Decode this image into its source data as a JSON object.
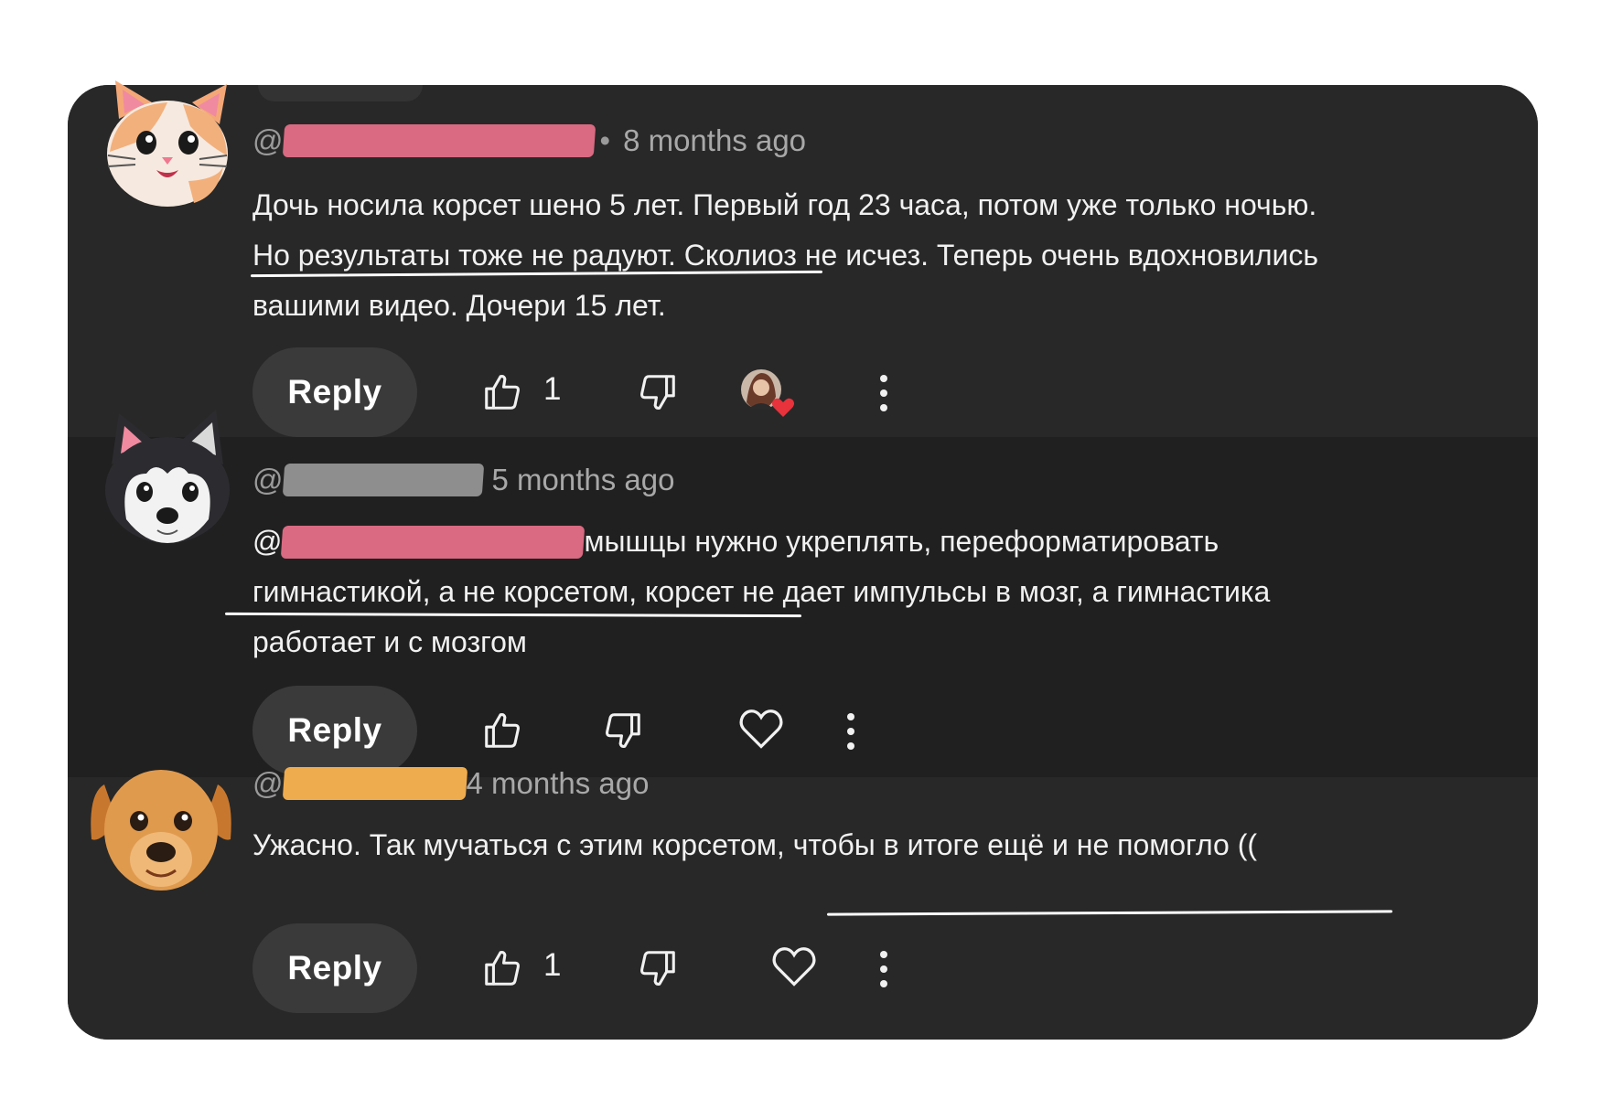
{
  "comments": [
    {
      "at": "@",
      "redact_color": "#d96a82",
      "dot": "•",
      "time": "8 months ago",
      "lines": [
        "Дочь носила корсет шено 5 лет. Первый год 23 часа, потом уже только ночью.",
        "Но результаты тоже не радуют. Сколиоз не исчез. Теперь очень вдохновились",
        "вашими  видео. Дочери  15 лет."
      ],
      "reply_label": "Reply",
      "like_count": "1",
      "avatar": "cat-avatar"
    },
    {
      "at": "@",
      "redact_color": "#8e8e8e",
      "time": "5 months ago",
      "mention_at": "@",
      "mention_redact_color": "#d96a82",
      "lines": [
        "мышцы нужно укреплять, переформатировать",
        "гимнастикой, а не корсетом, корсет не дает импульсы в мозг, а гимнастика",
        "работает и с мозгом"
      ],
      "reply_label": "Reply",
      "avatar": "husky-avatar"
    },
    {
      "at": "@",
      "redact_color": "#efac4e",
      "time": "4 months ago",
      "lines": [
        "Ужасно. Так мучаться с этим корсетом, чтобы в итоге ещё и не помогло (("
      ],
      "reply_label": "Reply",
      "like_count": "1",
      "avatar": "dog-avatar"
    }
  ],
  "colors": {
    "panel": "#282828",
    "highlight_row": "#202020",
    "text": "#f1f1f1",
    "meta": "#9a9a9a",
    "heart_badge": "#e8323c"
  }
}
